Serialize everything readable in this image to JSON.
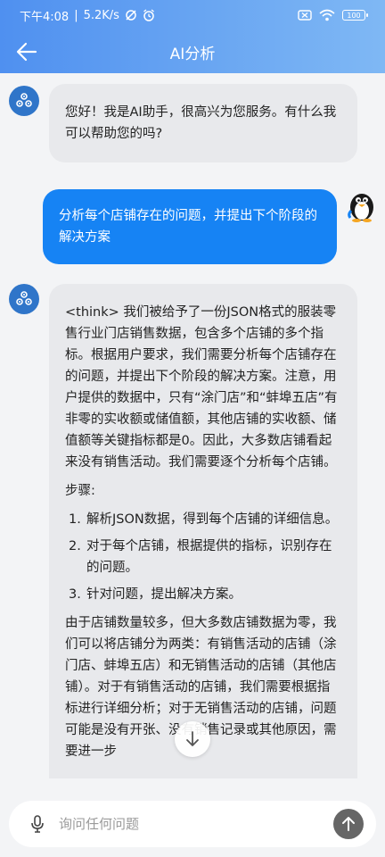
{
  "status": {
    "time": "下午4:08",
    "network_speed": "5.2K/s",
    "battery": "100"
  },
  "appbar": {
    "title": "AI分析"
  },
  "messages": {
    "ai1": "您好！我是AI助手，很高兴为您服务。有什么我可以帮助您的吗?",
    "user1": "分析每个店铺存在的问题，并提出下个阶段的解决方案",
    "ai2": {
      "para1": "<think> 我们被给予了一份JSON格式的服装零售行业门店销售数据，包含多个店铺的多个指标。根据用户要求，我们需要分析每个店铺存在的问题，并提出下个阶段的解决方案。注意，用户提供的数据中，只有“涂门店”和“蚌埠五店”有非零的实收额或储值额，其他店铺的实收额、储值额等关键指标都是0。因此，大多数店铺看起来没有销售活动。我们需要逐个分析每个店铺。",
      "steps_title": "步骤:",
      "steps": [
        {
          "num": "1.",
          "text": "解析JSON数据，得到每个店铺的详细信息。"
        },
        {
          "num": "2.",
          "text": "对于每个店铺，根据提供的指标，识别存在的问题。"
        },
        {
          "num": "3.",
          "text": "针对问题，提出解决方案。"
        }
      ],
      "para2": "由于店铺数量较多，但大多数店铺数据为零，我们可以将店铺分为两类：有销售活动的店铺（涂门店、蚌埠五店）和无销售活动的店铺（其他店铺）。对于有销售活动的店铺，我们需要根据指标进行详细分析；对于无销售活动的店铺，问题可能是没有开张、没有销售记录或其他原因，需要进一步"
    }
  },
  "input": {
    "placeholder": "询问任何问题"
  },
  "colors": {
    "header_start": "#4f90f0",
    "header_end": "#7fb8f4",
    "user_bubble": "#1683f4",
    "ai_bubble": "#e8e9ec"
  }
}
